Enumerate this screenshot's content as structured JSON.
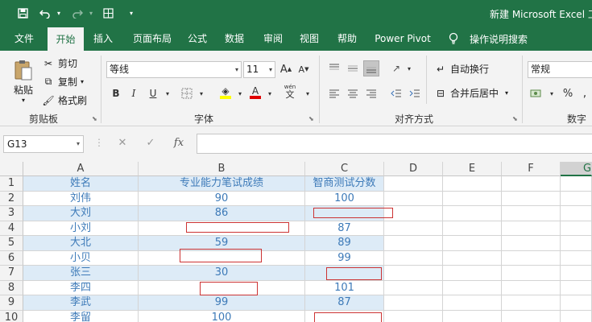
{
  "titlebar": {
    "doc_title": "新建 Microsoft Excel 工",
    "icons": [
      "save-icon",
      "undo-icon",
      "undo-dropdown-icon",
      "redo-icon",
      "table-icon",
      "customize-dropdown-icon"
    ]
  },
  "tabs": [
    "文件",
    "开始",
    "插入",
    "页面布局",
    "公式",
    "数据",
    "审阅",
    "视图",
    "帮助",
    "Power Pivot"
  ],
  "active_tab": "开始",
  "tell_me": "操作说明搜索",
  "clipboard": {
    "paste": "粘贴",
    "cut": "剪切",
    "copy": "复制",
    "format_painter": "格式刷",
    "group": "剪贴板"
  },
  "font": {
    "name": "等线",
    "size": "11",
    "group": "字体",
    "bold": "B",
    "italic": "I",
    "underline": "U",
    "grow": "A",
    "shrink": "A",
    "wen": "wén",
    "wen_char": "文"
  },
  "alignment": {
    "wrap": "自动换行",
    "merge": "合并后居中",
    "group": "对齐方式"
  },
  "number": {
    "format": "常规",
    "group": "数字",
    "percent": "%",
    "comma": ","
  },
  "formula_bar": {
    "name_box": "G13",
    "fx": "fx",
    "cancel": "✕",
    "enter": "✓",
    "formula": ""
  },
  "columns": [
    "A",
    "B",
    "C",
    "D",
    "E",
    "F",
    "G"
  ],
  "selected_column": "G",
  "rows": [
    {
      "num": "1",
      "a": "姓名",
      "b": "专业能力笔试成绩",
      "c": "智商测试分数"
    },
    {
      "num": "2",
      "a": "刘伟",
      "b": "90",
      "c": "100"
    },
    {
      "num": "3",
      "a": "大刘",
      "b": "86",
      "c": ""
    },
    {
      "num": "4",
      "a": "小刘",
      "b": "",
      "c": "87"
    },
    {
      "num": "5",
      "a": "大北",
      "b": "59",
      "c": "89"
    },
    {
      "num": "6",
      "a": "小贝",
      "b": "",
      "c": "99"
    },
    {
      "num": "7",
      "a": "张三",
      "b": "30",
      "c": ""
    },
    {
      "num": "8",
      "a": "李四",
      "b": "",
      "c": "101"
    },
    {
      "num": "9",
      "a": "李武",
      "b": "99",
      "c": "87"
    },
    {
      "num": "10",
      "a": "李留",
      "b": "100",
      "c": ""
    }
  ]
}
